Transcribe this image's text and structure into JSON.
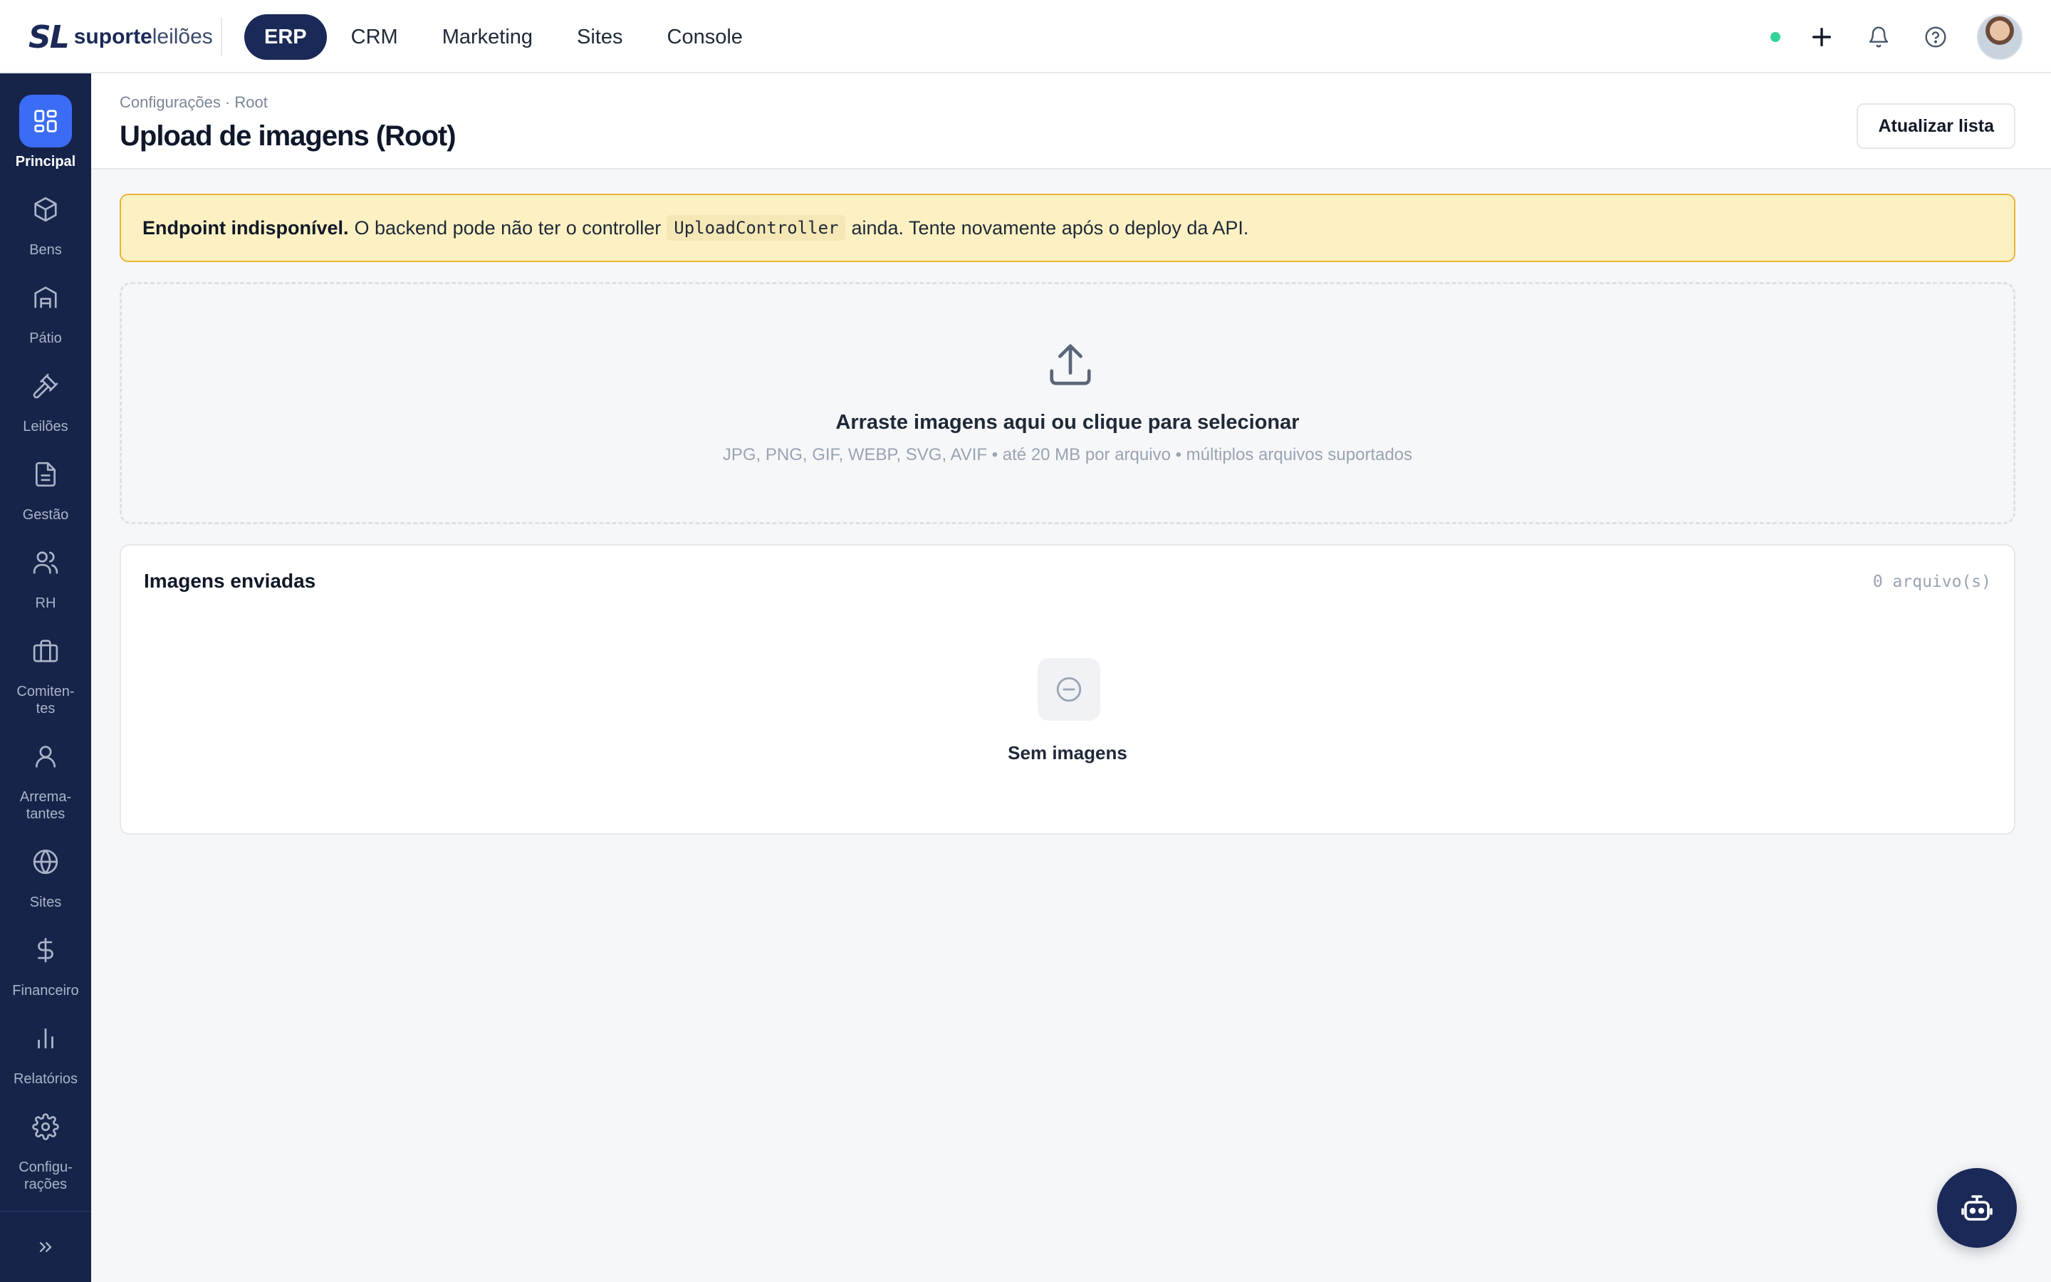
{
  "brand": {
    "mark": "SL",
    "name_bold": "suporte",
    "name_light": "leilões"
  },
  "topnav": {
    "tabs": [
      {
        "label": "ERP",
        "active": true
      },
      {
        "label": "CRM",
        "active": false
      },
      {
        "label": "Marketing",
        "active": false
      },
      {
        "label": "Sites",
        "active": false
      },
      {
        "label": "Console",
        "active": false
      }
    ]
  },
  "top_actions": {
    "status_color": "#34d399",
    "icons": [
      "plus-icon",
      "bell-icon",
      "help-icon"
    ]
  },
  "sidebar": {
    "items": [
      {
        "label": "Principal",
        "icon": "dashboard-icon",
        "active": true
      },
      {
        "label": "Bens",
        "icon": "box-icon",
        "active": false
      },
      {
        "label": "Pátio",
        "icon": "warehouse-icon",
        "active": false
      },
      {
        "label": "Leilões",
        "icon": "gavel-icon",
        "active": false
      },
      {
        "label": "Gestão",
        "icon": "document-icon",
        "active": false
      },
      {
        "label": "RH",
        "icon": "users-icon",
        "active": false
      },
      {
        "label": "Comiten-\ntes",
        "icon": "briefcase-icon",
        "active": false
      },
      {
        "label": "Arrema-\ntantes",
        "icon": "user-icon",
        "active": false
      },
      {
        "label": "Sites",
        "icon": "globe-icon",
        "active": false
      },
      {
        "label": "Financeiro",
        "icon": "dollar-icon",
        "active": false
      },
      {
        "label": "Relatórios",
        "icon": "bar-chart-icon",
        "active": false
      },
      {
        "label": "Configu-\nrações",
        "icon": "gear-icon",
        "active": false
      }
    ],
    "expand_icon": "chevrons-right-icon"
  },
  "header": {
    "breadcrumb": "Configurações · Root",
    "title": "Upload de imagens (Root)",
    "refresh_label": "Atualizar lista"
  },
  "alert": {
    "bold": "Endpoint indisponível.",
    "text_before": "O backend pode não ter o controller",
    "code": "UploadController",
    "text_after": "ainda. Tente novamente após o deploy da API.",
    "bg_color": "#fdf1c4",
    "border_color": "#e9b437"
  },
  "dropzone": {
    "title": "Arraste imagens aqui ou clique para selecionar",
    "subtitle": "JPG, PNG, GIF, WEBP, SVG, AVIF • até 20 MB por arquivo • múltiplos arquivos suportados",
    "icon": "upload-icon"
  },
  "uploads": {
    "title": "Imagens enviadas",
    "count": "0 arquivo(s)",
    "empty_text": "Sem imagens",
    "empty_icon": "minus-circle-icon"
  },
  "assistant": {
    "icon": "robot-icon"
  },
  "colors": {
    "navy": "#1a2957",
    "accent_blue": "#3b6cf6",
    "sidebar_bg": "#16244a"
  }
}
